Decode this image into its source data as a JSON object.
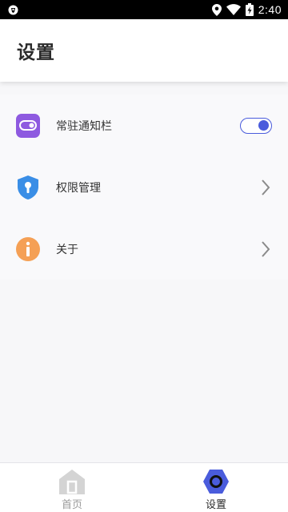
{
  "status_bar": {
    "time": "2:40",
    "icons": [
      "app-notification-icon",
      "location-icon",
      "wifi-icon",
      "battery-charging-icon"
    ]
  },
  "header": {
    "title": "设置"
  },
  "settings": {
    "items": [
      {
        "label": "常驻通知栏",
        "icon": "notification-toggle-icon",
        "control": "toggle",
        "toggle_on": true
      },
      {
        "label": "权限管理",
        "icon": "shield-keyhole-icon",
        "control": "chevron"
      },
      {
        "label": "关于",
        "icon": "info-icon",
        "control": "chevron"
      }
    ]
  },
  "bottom_nav": {
    "tabs": [
      {
        "label": "首页",
        "icon": "home-icon",
        "active": false
      },
      {
        "label": "设置",
        "icon": "hexagon-settings-icon",
        "active": true
      }
    ]
  },
  "colors": {
    "accent": "#4a5cdc",
    "purple_icon": "#8e5ae0",
    "blue_icon": "#3a8ee6",
    "orange_icon": "#f5a055",
    "inactive_tab": "#cfcfcf"
  }
}
